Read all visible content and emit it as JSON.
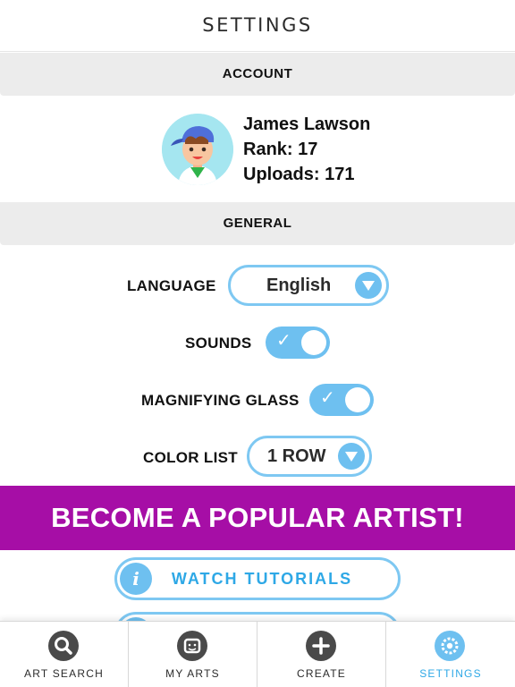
{
  "header": {
    "title": "SETTINGS"
  },
  "account": {
    "section_title": "ACCOUNT",
    "name": "James Lawson",
    "rank": "Rank: 17",
    "uploads": "Uploads: 171"
  },
  "general": {
    "section_title": "GENERAL",
    "language": {
      "label": "LANGUAGE",
      "value": "English"
    },
    "sounds": {
      "label": "SOUNDS",
      "on": true
    },
    "magnifying_glass": {
      "label": "MAGNIFYING GLASS",
      "on": true
    },
    "color_list": {
      "label": "COLOR LIST",
      "value": "1 ROW"
    }
  },
  "banner": {
    "text": "BECOME A POPULAR ARTIST!"
  },
  "buttons": {
    "watch_tutorials": "WATCH TUTORIALS"
  },
  "tabbar": {
    "tabs": [
      {
        "label": "ART SEARCH",
        "icon": "search-icon",
        "active": false
      },
      {
        "label": "MY ARTS",
        "icon": "gallery-icon",
        "active": false
      },
      {
        "label": "CREATE",
        "icon": "plus-icon",
        "active": false
      },
      {
        "label": "SETTINGS",
        "icon": "gear-icon",
        "active": true
      }
    ]
  },
  "colors": {
    "accent": "#6ec0f0",
    "accent_text": "#2ea8e6",
    "banner": "#a60ea6",
    "section_bg": "#ececec"
  }
}
